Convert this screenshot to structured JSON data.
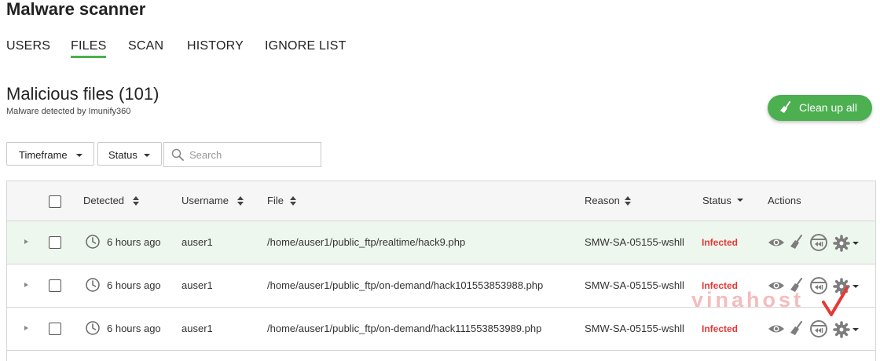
{
  "app": {
    "title": "Malware scanner"
  },
  "tabs": [
    {
      "label": "USERS",
      "active": false
    },
    {
      "label": "FILES",
      "active": true
    },
    {
      "label": "SCAN",
      "active": false
    },
    {
      "label": "HISTORY",
      "active": false
    },
    {
      "label": "IGNORE LIST",
      "active": false
    }
  ],
  "page": {
    "title": "Malicious files (101)",
    "subtitle": "Malware detected by Imunify360"
  },
  "actions": {
    "cleanup_label": "Clean up all"
  },
  "filters": {
    "timeframe_label": "Timeframe",
    "status_label": "Status",
    "search_placeholder": "Search"
  },
  "table": {
    "columns": {
      "detected": "Detected",
      "username": "Username",
      "file": "File",
      "reason": "Reason",
      "status": "Status",
      "actions": "Actions"
    },
    "rows": [
      {
        "detected": "6 hours ago",
        "username": "auser1",
        "file": "/home/auser1/public_ftp/realtime/hack9.php",
        "reason": "SMW-SA-05155-wshll",
        "status": "Infected"
      },
      {
        "detected": "6 hours ago",
        "username": "auser1",
        "file": "/home/auser1/public_ftp/on-demand/hack101553853988.php",
        "reason": "SMW-SA-05155-wshll",
        "status": "Infected"
      },
      {
        "detected": "6 hours ago",
        "username": "auser1",
        "file": "/home/auser1/public_ftp/on-demand/hack111553853989.php",
        "reason": "SMW-SA-05155-wshll",
        "status": "Infected"
      }
    ],
    "row_actions": [
      "eye-icon",
      "broom-icon",
      "skip-icon",
      "gear-icon"
    ]
  },
  "watermark": {
    "text": "vinahost"
  },
  "colors": {
    "accent": "#4caf50",
    "infected": "#e53935",
    "row_highlight": "#eef7ee",
    "watermark": "#e53935"
  }
}
